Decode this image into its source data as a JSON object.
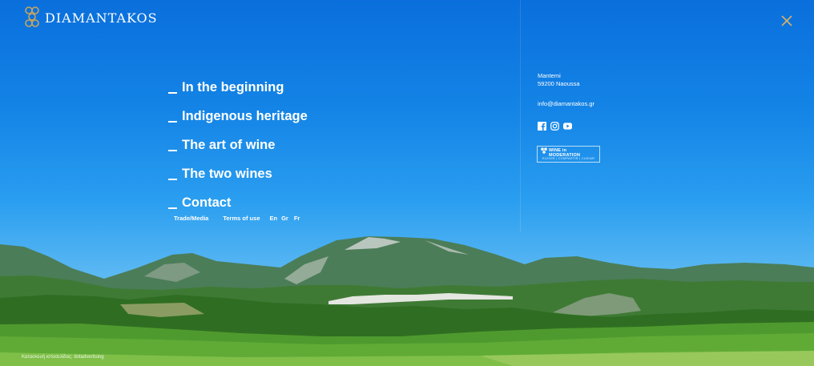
{
  "brand": {
    "name": "DIAMANTAKOS"
  },
  "navigation": [
    {
      "label": "In the beginning"
    },
    {
      "label": "Indigenous heritage"
    },
    {
      "label": "The art of wine"
    },
    {
      "label": "The two wines"
    },
    {
      "label": "Contact"
    }
  ],
  "secondary_links": {
    "trade_media": "Trade/Media",
    "terms": "Terms of use",
    "languages": [
      "En",
      "Gr",
      "Fr"
    ]
  },
  "contact": {
    "line1": "Mantemi",
    "line2": "59200 Naoussa",
    "email": "info@diamantakos.gr"
  },
  "social_icons": [
    "facebook-icon",
    "instagram-icon",
    "youtube-icon"
  ],
  "badge": {
    "title": "WINE in MODERATION",
    "tagline": "ELEGIR | COMPARTIR | CUIDAR"
  },
  "footer": {
    "credit": "Κατασκευή ιστοσελίδας: dotadvertising"
  },
  "colors": {
    "sky_top": "#0a6fdc",
    "sky_bottom": "#7cc6f0",
    "logo_gold": "#c9a45c",
    "close_gold": "#d8b26a"
  }
}
